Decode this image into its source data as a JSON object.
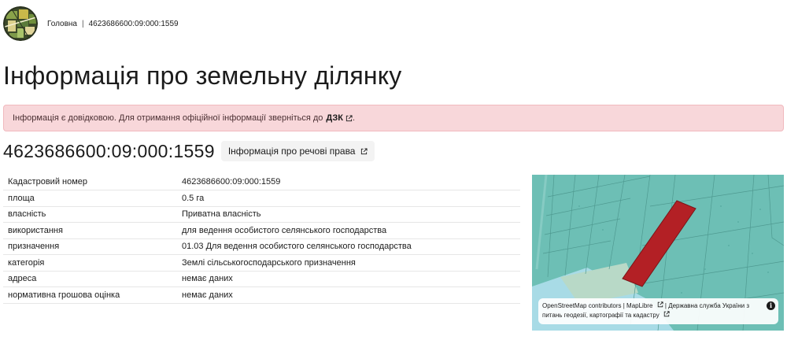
{
  "header": {
    "breadcrumb_home": "Головна",
    "breadcrumb_separator": "|",
    "breadcrumb_current": "4623686600:09:000:1559"
  },
  "page": {
    "title": "Інформація про земельну ділянку"
  },
  "alert": {
    "text": "Інформація є довідковою. Для отримання офіційної інформації зверніться до",
    "link_label": "ДЗК",
    "trailing": "."
  },
  "parcel": {
    "cadastral_id": "4623686600:09:000:1559",
    "rights_button_label": "Інформація про речові права"
  },
  "properties": [
    {
      "label": "Кадастровий номер",
      "value": "4623686600:09:000:1559"
    },
    {
      "label": "площа",
      "value": "0.5 га"
    },
    {
      "label": "власність",
      "value": "Приватна власність"
    },
    {
      "label": "використання",
      "value": "для ведення особистого селянського господарства"
    },
    {
      "label": "призначення",
      "value": "01.03 Для ведення особистого селянського господарства"
    },
    {
      "label": "категорія",
      "value": "Землі сільськогосподарського призначення"
    },
    {
      "label": "адреса",
      "value": "немає даних"
    },
    {
      "label": "нормативна грошова оцінка",
      "value": "немає даних"
    }
  ],
  "map": {
    "attribution_osm": "OpenStreetMap contributors",
    "attribution_sep1": "|",
    "attribution_maplibre": "MapLibre",
    "attribution_sep2": "|",
    "attribution_dzk": "Державна служба України з питань геодезії, картографії та кадастру",
    "info_label": "i",
    "colors": {
      "parcels": "#6dbfb5",
      "highlight": "#b32025",
      "water": "#a8dbe6",
      "outline": "#4f9a91"
    }
  },
  "icons": {
    "logo": "logo-emblem",
    "external": "external-link-icon",
    "info": "info-icon"
  }
}
